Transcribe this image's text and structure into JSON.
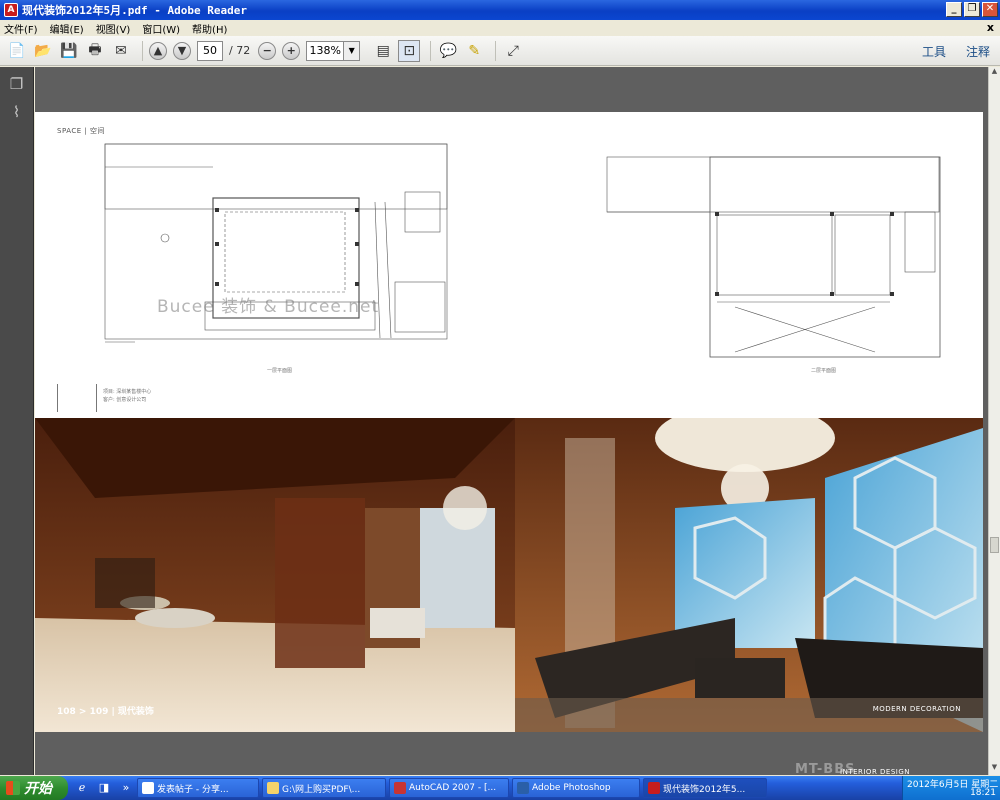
{
  "window": {
    "title": "现代装饰2012年5月.pdf - Adobe Reader",
    "buttons": {
      "minimize": "_",
      "restore": "❐",
      "close": "✕"
    }
  },
  "menu": {
    "items": [
      "文件(F)",
      "编辑(E)",
      "视图(V)",
      "窗口(W)",
      "帮助(H)"
    ],
    "close": "x"
  },
  "toolbar": {
    "page_current": "50",
    "page_total": "/ 72",
    "zoom": "138%",
    "tools_label": "工具",
    "comment_label": "注释"
  },
  "document": {
    "space_label": "SPACE | 空间",
    "watermark": "Bucee 装饰 & Bucee.net",
    "plan1_caption": "一层平面图",
    "plan2_caption": "二层平面图",
    "legend_lines": [
      "项目: 深圳某售楼中心",
      "客户: 创意设计公司"
    ],
    "page_numbers": "108 > 109 | 现代装饰",
    "photo_caption": "MODERN DECORATION"
  },
  "taskbar": {
    "start_label": "开始",
    "tasks": [
      "发表帖子 - 分享...",
      "G:\\网上购买PDF\\...",
      "AutoCAD 2007 - [...",
      "Adobe Photoshop",
      "现代装饰2012年5..."
    ],
    "date": "2012年6月5日 星期二",
    "time": "18:21"
  },
  "watermark_logo": {
    "text": "MT-BBS",
    "sub": "INTERIOR DESIGN"
  },
  "colors": {
    "titlebar": "#0a3fc4",
    "taskbar": "#245edb",
    "start": "#2f8d2f",
    "doc_bg": "#5f5f5f"
  }
}
